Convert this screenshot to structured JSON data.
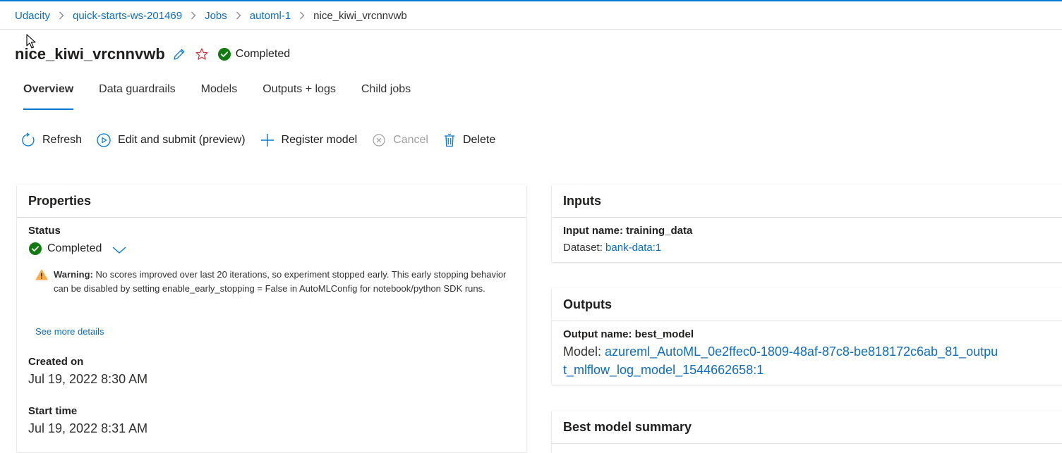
{
  "breadcrumb": [
    "Udacity",
    "quick-starts-ws-201469",
    "Jobs",
    "automl-1"
  ],
  "breadcrumb_current": "nice_kiwi_vrcnnvwb",
  "header": {
    "title": "nice_kiwi_vrcnnvwb",
    "status": "Completed"
  },
  "tabs": [
    "Overview",
    "Data guardrails",
    "Models",
    "Outputs + logs",
    "Child jobs"
  ],
  "toolbar": {
    "refresh": "Refresh",
    "edit_submit": "Edit and submit (preview)",
    "register": "Register model",
    "cancel": "Cancel",
    "delete": "Delete"
  },
  "properties": {
    "title": "Properties",
    "status_label": "Status",
    "status_value": "Completed",
    "warning_prefix": "Warning:",
    "warning_text": "No scores improved over last 20 iterations, so experiment stopped early. This early stopping behavior can be disabled by setting enable_early_stopping = False in AutoMLConfig for notebook/python SDK runs.",
    "see_more": "See more details",
    "created_label": "Created on",
    "created_value": "Jul 19, 2022 8:30 AM",
    "start_label": "Start time",
    "start_value": "Jul 19, 2022 8:31 AM"
  },
  "inputs": {
    "title": "Inputs",
    "input_name": "Input name: training_data",
    "dataset_prefix": "Dataset:",
    "dataset_link": "bank-data:1"
  },
  "outputs": {
    "title": "Outputs",
    "output_name": "Output name: best_model",
    "model_prefix": "Model:",
    "model_link": "azureml_AutoML_0e2ffec0-1809-48af-87c8-be818172c6ab_81_output_mlflow_log_model_1544662658:1"
  },
  "best_model": {
    "title": "Best model summary"
  },
  "colors": {
    "accent": "#0078d4",
    "link": "#0f6cbd",
    "success": "#107c10",
    "warning": "#ffaa44"
  }
}
